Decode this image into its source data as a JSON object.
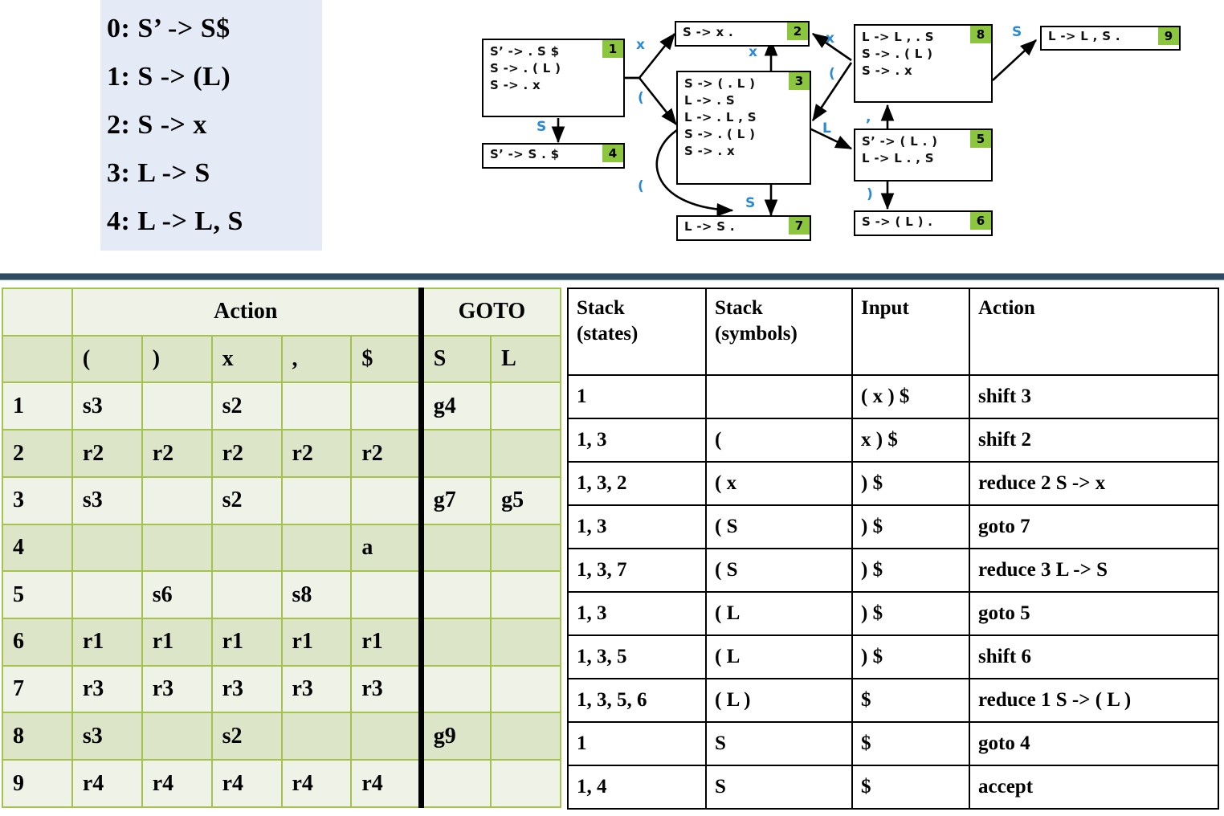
{
  "grammar": {
    "rules": [
      "0: S’ -> S$",
      "1: S -> (L)",
      "2: S -> x",
      "3: L -> S",
      "4: L -> L, S"
    ],
    "background_color": "#e4ebf6"
  },
  "automaton": {
    "badge_color": "#8cc63e",
    "edge_label_color": "#2a8ad4",
    "states": [
      {
        "id": "1",
        "items": [
          "S’ -> . S $",
          "S -> . ( L )",
          "S -> . x"
        ]
      },
      {
        "id": "2",
        "items": [
          "S -> x ."
        ]
      },
      {
        "id": "3",
        "items": [
          "S -> ( . L )",
          "L -> . S",
          "L -> . L , S",
          "S -> . ( L )",
          "S -> . x"
        ]
      },
      {
        "id": "4",
        "items": [
          "S’ -> S . $"
        ]
      },
      {
        "id": "5",
        "items": [
          "S’ -> ( L . )",
          "L -> L . , S"
        ]
      },
      {
        "id": "6",
        "items": [
          "S -> ( L ) ."
        ]
      },
      {
        "id": "7",
        "items": [
          "L -> S ."
        ]
      },
      {
        "id": "8",
        "items": [
          "L -> L , . S",
          "S -> . ( L )",
          "S -> . x"
        ]
      },
      {
        "id": "9",
        "items": [
          "L -> L , S ."
        ]
      }
    ],
    "edges": [
      {
        "from": "1",
        "to": "2",
        "label": "x"
      },
      {
        "from": "1",
        "to": "3",
        "label": "("
      },
      {
        "from": "1",
        "to": "4",
        "label": "S"
      },
      {
        "from": "3",
        "to": "2",
        "label": "x"
      },
      {
        "from": "3",
        "to": "3",
        "label": "("
      },
      {
        "from": "3",
        "to": "7",
        "label": "S"
      },
      {
        "from": "3",
        "to": "5",
        "label": "L"
      },
      {
        "from": "5",
        "to": "8",
        "label": ","
      },
      {
        "from": "5",
        "to": "6",
        "label": ")"
      },
      {
        "from": "8",
        "to": "2",
        "label": "x"
      },
      {
        "from": "8",
        "to": "3",
        "label": "("
      },
      {
        "from": "8",
        "to": "9",
        "label": "S"
      }
    ]
  },
  "parse_table": {
    "group_headers": [
      "",
      "Action",
      "GOTO"
    ],
    "action_label": "Action",
    "goto_label": "GOTO",
    "action_columns": [
      "(",
      ")",
      "x",
      ",",
      "$"
    ],
    "goto_columns": [
      "S",
      "L"
    ],
    "rows": [
      {
        "state": "1",
        "action": [
          "s3",
          "",
          "s2",
          "",
          ""
        ],
        "goto": [
          "g4",
          ""
        ]
      },
      {
        "state": "2",
        "action": [
          "r2",
          "r2",
          "r2",
          "r2",
          "r2"
        ],
        "goto": [
          "",
          ""
        ]
      },
      {
        "state": "3",
        "action": [
          "s3",
          "",
          "s2",
          "",
          ""
        ],
        "goto": [
          "g7",
          "g5"
        ]
      },
      {
        "state": "4",
        "action": [
          "",
          "",
          "",
          "",
          "a"
        ],
        "goto": [
          "",
          ""
        ]
      },
      {
        "state": "5",
        "action": [
          "",
          "s6",
          "",
          "s8",
          ""
        ],
        "goto": [
          "",
          ""
        ]
      },
      {
        "state": "6",
        "action": [
          "r1",
          "r1",
          "r1",
          "r1",
          "r1"
        ],
        "goto": [
          "",
          ""
        ]
      },
      {
        "state": "7",
        "action": [
          "r3",
          "r3",
          "r3",
          "r3",
          "r3"
        ],
        "goto": [
          "",
          ""
        ]
      },
      {
        "state": "8",
        "action": [
          "s3",
          "",
          "s2",
          "",
          ""
        ],
        "goto": [
          "g9",
          ""
        ]
      },
      {
        "state": "9",
        "action": [
          "r4",
          "r4",
          "r4",
          "r4",
          "r4"
        ],
        "goto": [
          "",
          ""
        ]
      }
    ]
  },
  "trace_table": {
    "headers": [
      {
        "line1": "Stack",
        "line2": "(states)"
      },
      {
        "line1": "Stack",
        "line2": "(symbols)"
      },
      {
        "line1": "Input",
        "line2": ""
      },
      {
        "line1": "Action",
        "line2": ""
      }
    ],
    "rows": [
      {
        "states": "1",
        "symbols": "",
        "input": "( x ) $",
        "action": "shift 3"
      },
      {
        "states": "1, 3",
        "symbols": "(",
        "input": "x ) $",
        "action": "shift 2"
      },
      {
        "states": "1, 3, 2",
        "symbols": "( x",
        "input": ") $",
        "action": "reduce 2 S -> x"
      },
      {
        "states": "1, 3",
        "symbols": "( S",
        "input": ") $",
        "action": "goto 7"
      },
      {
        "states": "1, 3, 7",
        "symbols": "( S",
        "input": ") $",
        "action": "reduce 3 L -> S"
      },
      {
        "states": "1, 3",
        "symbols": "( L",
        "input": ") $",
        "action": "goto 5"
      },
      {
        "states": "1, 3, 5",
        "symbols": "( L",
        "input": ") $",
        "action": "shift 6"
      },
      {
        "states": "1, 3, 5, 6",
        "symbols": "( L )",
        "input": "$",
        "action": "reduce 1 S -> ( L )"
      },
      {
        "states": "1",
        "symbols": "S",
        "input": "$",
        "action": "goto 4"
      },
      {
        "states": "1, 4",
        "symbols": "S",
        "input": "$",
        "action": "accept"
      }
    ]
  },
  "colors": {
    "divider": "#2f4a63",
    "table_border": "#a5c24f",
    "row_light": "#eff3e7",
    "row_dark": "#dde5c9",
    "header_blue": "#1a1ae0",
    "symbol_blue": "#2a8ad4",
    "badge_green": "#8cc63e"
  }
}
